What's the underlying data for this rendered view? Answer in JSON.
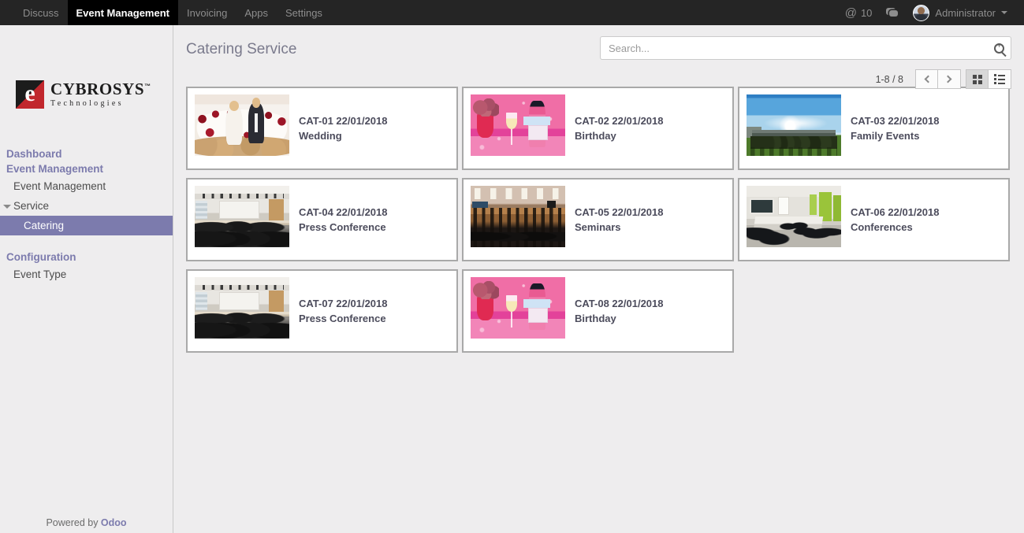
{
  "topbar": {
    "menu_items": [
      {
        "label": "Discuss",
        "active": false
      },
      {
        "label": "Event Management",
        "active": true
      },
      {
        "label": "Invoicing",
        "active": false
      },
      {
        "label": "Apps",
        "active": false
      },
      {
        "label": "Settings",
        "active": false
      }
    ],
    "mentions_glyph": "@",
    "mentions_count": "10",
    "user_name": "Administrator"
  },
  "sidebar": {
    "logo_name": "CYBROSYS",
    "logo_tm": "™",
    "logo_sub": "Technologies",
    "logo_mark_letter": "e",
    "nav": [
      {
        "type": "head",
        "label": "Dashboard"
      },
      {
        "type": "head",
        "label": "Event Management"
      },
      {
        "type": "link",
        "label": "Event Management"
      },
      {
        "type": "toggle",
        "label": "Service"
      },
      {
        "type": "sub-selected",
        "label": "Catering"
      },
      {
        "type": "gap"
      },
      {
        "type": "head",
        "label": "Configuration"
      },
      {
        "type": "link",
        "label": "Event Type"
      }
    ],
    "powered_prefix": "Powered by ",
    "powered_brand": "Odoo"
  },
  "control_panel": {
    "page_title": "Catering Service",
    "search_placeholder": "Search...",
    "search_value": "",
    "pager": "1-8 / 8",
    "prev_label": "Previous",
    "next_label": "Next",
    "kanban_view_label": "Kanban",
    "list_view_label": "List",
    "active_view": "kanban"
  },
  "records": [
    {
      "ref": "CAT-01 22/01/2018",
      "name": "Wedding",
      "thumb": "wedding"
    },
    {
      "ref": "CAT-02 22/01/2018",
      "name": "Birthday",
      "thumb": "birthday"
    },
    {
      "ref": "CAT-03 22/01/2018",
      "name": "Family Events",
      "thumb": "family"
    },
    {
      "ref": "CAT-04 22/01/2018",
      "name": "Press Conference",
      "thumb": "press"
    },
    {
      "ref": "CAT-05 22/01/2018",
      "name": "Seminars",
      "thumb": "seminar"
    },
    {
      "ref": "CAT-06 22/01/2018",
      "name": "Conferences",
      "thumb": "conf"
    },
    {
      "ref": "CAT-07 22/01/2018",
      "name": "Press Conference",
      "thumb": "press"
    },
    {
      "ref": "CAT-08 22/01/2018",
      "name": "Birthday",
      "thumb": "birthday"
    }
  ],
  "colors": {
    "topbar_bg": "#252525",
    "accent_purple": "#7c7bad",
    "content_bg": "#eeedee",
    "card_border": "#a9a9a9",
    "logo_red": "#c1272d"
  }
}
